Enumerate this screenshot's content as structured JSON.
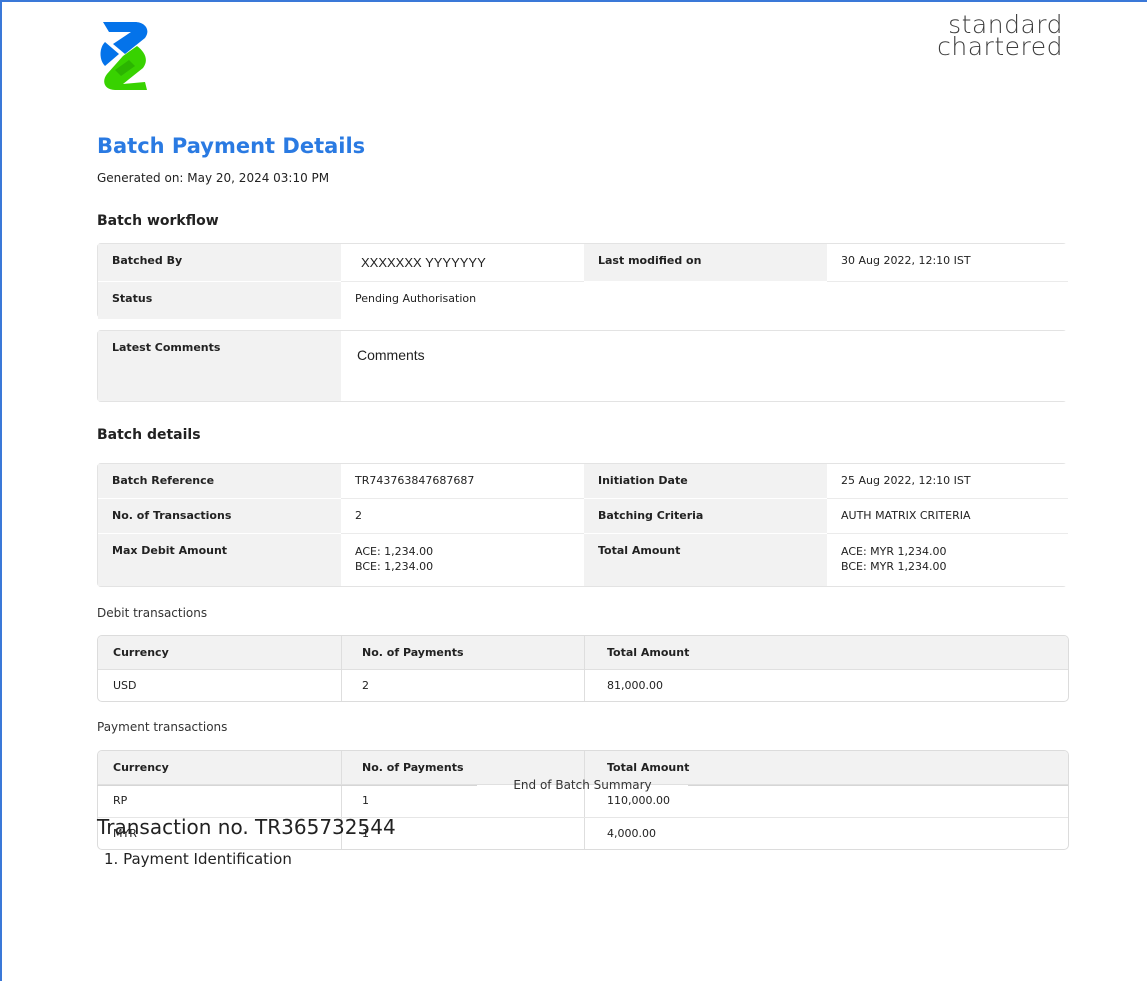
{
  "brand": {
    "name_line1": "standard",
    "name_line2": "chartered",
    "logo_icon": "sc-logo-icon"
  },
  "title": "Batch Payment Details",
  "generated_on": "Generated on: May 20, 2024 03:10 PM",
  "workflow": {
    "heading": "Batch workflow",
    "batched_by_label": "Batched By",
    "batched_by_value": "XXXXXXX YYYYYYY",
    "last_modified_label": "Last modified on",
    "last_modified_value": "30 Aug 2022, 12:10 IST",
    "status_label": "Status",
    "status_value": "Pending Authorisation",
    "comments_label": "Latest Comments",
    "comments_value": "Comments"
  },
  "details": {
    "heading": "Batch details",
    "reference_label": "Batch Reference",
    "reference_value": "TR743763847687687",
    "initiation_label": "Initiation Date",
    "initiation_value": "25 Aug 2022, 12:10 IST",
    "txn_count_label": "No. of Transactions",
    "txn_count_value": "2",
    "criteria_label": "Batching Criteria",
    "criteria_value": "AUTH MATRIX CRITERIA",
    "max_debit_label": "Max Debit Amount",
    "max_debit_line1": "ACE: 1,234.00",
    "max_debit_line2": "BCE: 1,234.00",
    "total_label": "Total Amount",
    "total_line1": "ACE: MYR 1,234.00",
    "total_line2": "BCE: MYR 1,234.00"
  },
  "debit": {
    "heading": "Debit transactions",
    "headers": [
      "Currency",
      "No. of Payments",
      "Total Amount"
    ],
    "rows": [
      [
        "USD",
        "2",
        "81,000.00"
      ]
    ]
  },
  "payment": {
    "heading": "Payment transactions",
    "headers": [
      "Currency",
      "No. of Payments",
      "Total Amount"
    ],
    "rows": [
      [
        "RP",
        "1",
        "110,000.00"
      ],
      [
        "MYR",
        "1",
        "4,000.00"
      ]
    ]
  },
  "end_summary": "End of Batch Summary",
  "transaction_title": "Transaction no. TR365732544",
  "transaction_section": "1. Payment Identification"
}
